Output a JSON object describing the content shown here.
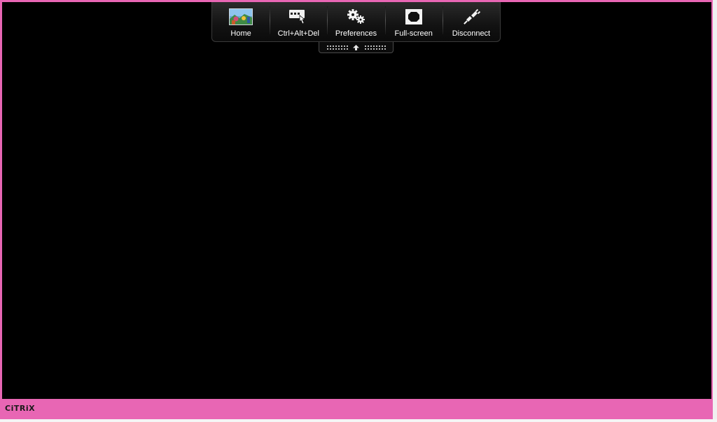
{
  "toolbar": {
    "buttons": [
      {
        "label": "Home",
        "icon": "desktop-photo-icon"
      },
      {
        "label": "Ctrl+Alt+Del",
        "icon": "keyboard-hand-icon"
      },
      {
        "label": "Preferences",
        "icon": "gears-icon"
      },
      {
        "label": "Full-screen",
        "icon": "fullscreen-icon"
      },
      {
        "label": "Disconnect",
        "icon": "unplug-icon"
      }
    ],
    "handle_icon": "arrow-up-icon"
  },
  "footer": {
    "logo_text": "CiTRiX"
  },
  "colors": {
    "frame": "#e866b4",
    "session_background": "#000000",
    "toolbar": "#121212"
  }
}
